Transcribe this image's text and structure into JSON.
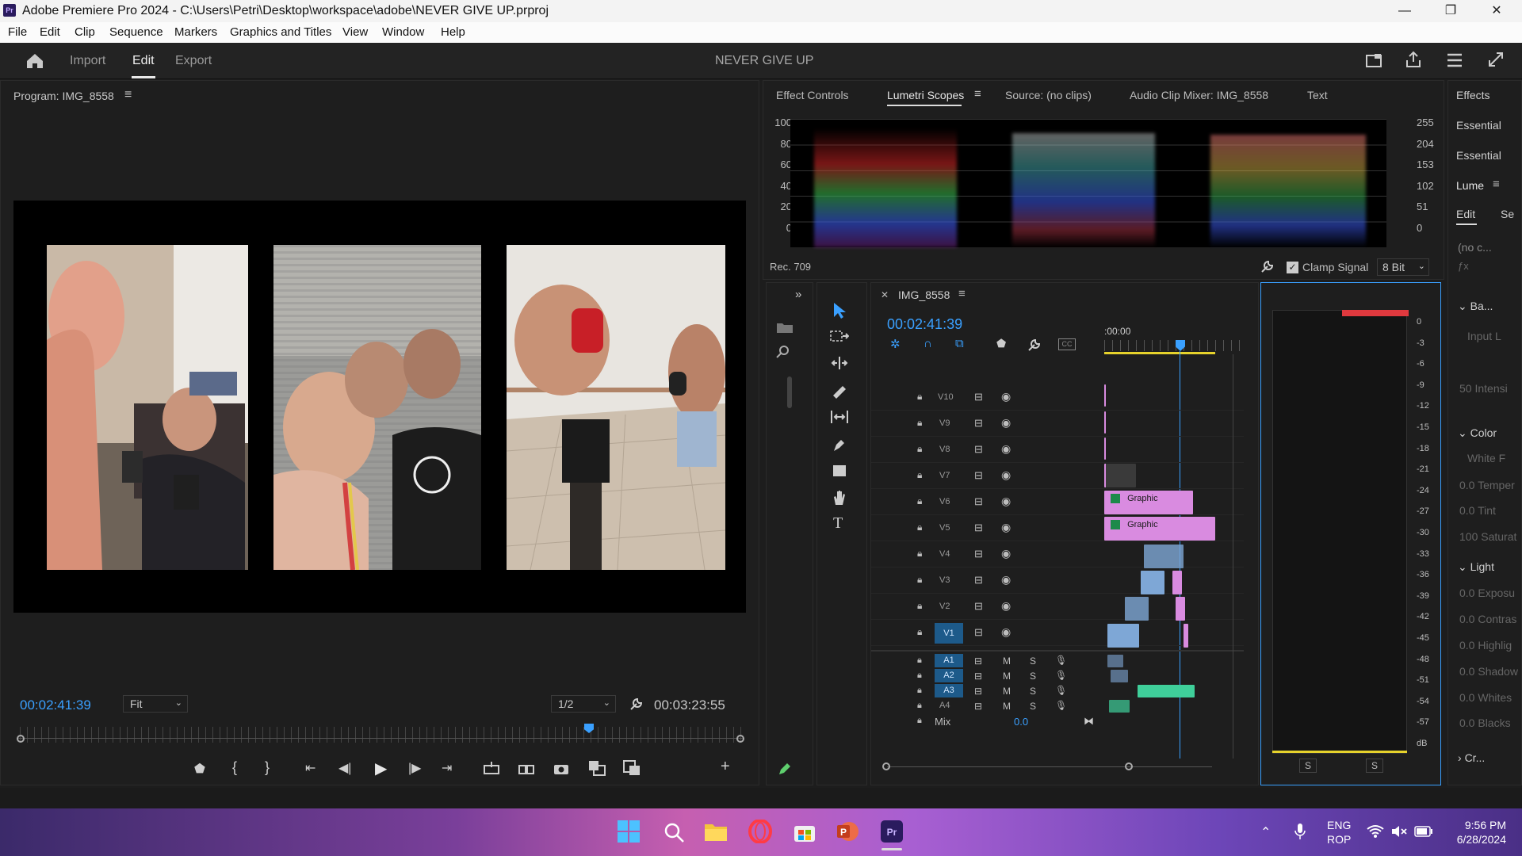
{
  "window": {
    "app_icon": "Pr",
    "title": "Adobe Premiere Pro 2024 - C:\\Users\\Petri\\Desktop\\workspace\\adobe\\NEVER GIVE UP.prproj",
    "minimize": "—",
    "restore": "❐",
    "close": "✕"
  },
  "menu": [
    "File",
    "Edit",
    "Clip",
    "Sequence",
    "Markers",
    "Graphics and Titles",
    "View",
    "Window",
    "Help"
  ],
  "header": {
    "tabs": [
      "Import",
      "Edit",
      "Export"
    ],
    "active_tab": "Edit",
    "project_title": "NEVER GIVE UP"
  },
  "program": {
    "title": "Program: IMG_8558",
    "menu_icon": "≡",
    "timecode": "00:02:41:39",
    "fit": "Fit",
    "resolution": "1/2",
    "duration": "00:03:23:55"
  },
  "top_panel": {
    "tabs": [
      "Effect Controls",
      "Lumetri Scopes",
      "Source: (no clips)",
      "Audio Clip Mixer: IMG_8558",
      "Text"
    ],
    "active_tab": "Lumetri Scopes",
    "left_scale": [
      "100",
      "80",
      "60",
      "40",
      "20",
      "0"
    ],
    "right_scale": [
      "255",
      "204",
      "153",
      "102",
      "51",
      "0"
    ],
    "color_space": "Rec. 709",
    "clamp_signal": "Clamp Signal",
    "bit_depth": "8 Bit"
  },
  "timeline": {
    "sequence": "IMG_8558",
    "timecode": "00:02:41:39",
    "ruler_start": ":00:00",
    "video_tracks": [
      "V10",
      "V9",
      "V8",
      "V7",
      "V6",
      "V5",
      "V4",
      "V3",
      "V2",
      "V1"
    ],
    "audio_tracks": [
      "A1",
      "A2",
      "A3",
      "A4"
    ],
    "mix_label": "Mix",
    "mix_value": "0.0",
    "graphic_label": "Graphic",
    "m_label": "M",
    "s_label": "S"
  },
  "audio_meter": {
    "scale": [
      "0",
      "-3",
      "-6",
      "-9",
      "-12",
      "-15",
      "-18",
      "-21",
      "-24",
      "-27",
      "-30",
      "-33",
      "-36",
      "-39",
      "-42",
      "-45",
      "-48",
      "-51",
      "-54",
      "-57",
      "dB"
    ],
    "solo_left": "S",
    "solo_right": "S"
  },
  "right_panel": {
    "tabs": [
      "Effects",
      "Essential",
      "Essential",
      "Lume"
    ],
    "subtabs": [
      "Edit",
      "Se"
    ],
    "no_clip": "(no c...",
    "sections": [
      "Ba...",
      "Color",
      "Light",
      "Cr..."
    ],
    "items": [
      "Input L",
      "50 Intensi",
      "White F",
      "0.0 Temper",
      "0.0 Tint",
      "100 Saturat",
      "0.0 Exposu",
      "0.0 Contras",
      "0.0 Highlig",
      "0.0 Shadow",
      "0.0 Whites",
      "0.0 Blacks"
    ]
  },
  "taskbar": {
    "lang_top": "ENG",
    "lang_bottom": "ROP",
    "time": "9:56 PM",
    "date": "6/28/2024"
  },
  "colors": {
    "accent_blue": "#3aa0ff",
    "graphic_clip": "#d98be0",
    "video_clip": "#7ea7d6",
    "audio_clip": "#3fcf9a",
    "meter_red": "#e0393e"
  }
}
